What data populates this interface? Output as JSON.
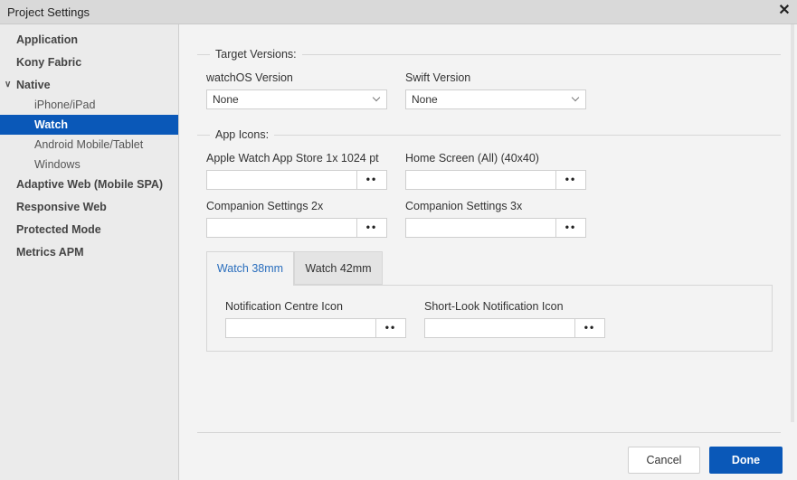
{
  "window": {
    "title": "Project Settings",
    "close_glyph": "✕"
  },
  "sidebar": {
    "items": [
      {
        "label": "Application"
      },
      {
        "label": "Kony Fabric"
      },
      {
        "label": "Native",
        "expanded": true
      },
      {
        "label": "iPhone/iPad"
      },
      {
        "label": "Watch",
        "selected": true
      },
      {
        "label": "Android Mobile/Tablet"
      },
      {
        "label": "Windows"
      },
      {
        "label": "Adaptive Web (Mobile SPA)"
      },
      {
        "label": "Responsive Web"
      },
      {
        "label": "Protected Mode"
      },
      {
        "label": "Metrics APM"
      }
    ]
  },
  "target_versions": {
    "title": "Target Versions:",
    "watchos": {
      "label": "watchOS Version",
      "value": "None"
    },
    "swift": {
      "label": "Swift Version",
      "value": "None"
    }
  },
  "app_icons": {
    "title": "App Icons:",
    "fields": [
      {
        "label": "Apple Watch App Store 1x 1024 pt",
        "value": ""
      },
      {
        "label": "Home Screen (All) (40x40)",
        "value": ""
      },
      {
        "label": "Companion Settings 2x",
        "value": ""
      },
      {
        "label": "Companion Settings 3x",
        "value": ""
      }
    ],
    "browse_glyph": "••"
  },
  "tabs": {
    "items": [
      {
        "label": "Watch 38mm",
        "active": true
      },
      {
        "label": "Watch 42mm",
        "active": false
      }
    ],
    "panel_fields": [
      {
        "label": "Notification Centre Icon",
        "value": ""
      },
      {
        "label": "Short-Look Notification Icon",
        "value": ""
      }
    ]
  },
  "footer": {
    "cancel_label": "Cancel",
    "done_label": "Done"
  },
  "colors": {
    "accent": "#0a58b8",
    "tab_active_text": "#2a6ebd"
  }
}
